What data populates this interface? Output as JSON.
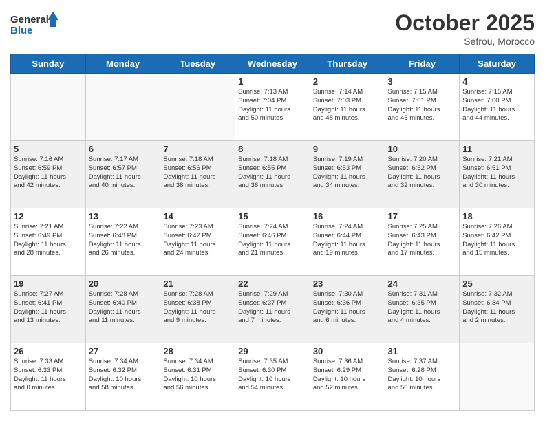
{
  "header": {
    "logo_line1": "General",
    "logo_line2": "Blue",
    "title": "October 2025",
    "location": "Sefrou, Morocco"
  },
  "days_of_week": [
    "Sunday",
    "Monday",
    "Tuesday",
    "Wednesday",
    "Thursday",
    "Friday",
    "Saturday"
  ],
  "weeks": [
    [
      {
        "day": "",
        "info": ""
      },
      {
        "day": "",
        "info": ""
      },
      {
        "day": "",
        "info": ""
      },
      {
        "day": "1",
        "info": "Sunrise: 7:13 AM\nSunset: 7:04 PM\nDaylight: 11 hours\nand 50 minutes."
      },
      {
        "day": "2",
        "info": "Sunrise: 7:14 AM\nSunset: 7:03 PM\nDaylight: 11 hours\nand 48 minutes."
      },
      {
        "day": "3",
        "info": "Sunrise: 7:15 AM\nSunset: 7:01 PM\nDaylight: 11 hours\nand 46 minutes."
      },
      {
        "day": "4",
        "info": "Sunrise: 7:15 AM\nSunset: 7:00 PM\nDaylight: 11 hours\nand 44 minutes."
      }
    ],
    [
      {
        "day": "5",
        "info": "Sunrise: 7:16 AM\nSunset: 6:59 PM\nDaylight: 11 hours\nand 42 minutes."
      },
      {
        "day": "6",
        "info": "Sunrise: 7:17 AM\nSunset: 6:57 PM\nDaylight: 11 hours\nand 40 minutes."
      },
      {
        "day": "7",
        "info": "Sunrise: 7:18 AM\nSunset: 6:56 PM\nDaylight: 11 hours\nand 38 minutes."
      },
      {
        "day": "8",
        "info": "Sunrise: 7:18 AM\nSunset: 6:55 PM\nDaylight: 11 hours\nand 36 minutes."
      },
      {
        "day": "9",
        "info": "Sunrise: 7:19 AM\nSunset: 6:53 PM\nDaylight: 11 hours\nand 34 minutes."
      },
      {
        "day": "10",
        "info": "Sunrise: 7:20 AM\nSunset: 6:52 PM\nDaylight: 11 hours\nand 32 minutes."
      },
      {
        "day": "11",
        "info": "Sunrise: 7:21 AM\nSunset: 6:51 PM\nDaylight: 11 hours\nand 30 minutes."
      }
    ],
    [
      {
        "day": "12",
        "info": "Sunrise: 7:21 AM\nSunset: 6:49 PM\nDaylight: 11 hours\nand 28 minutes."
      },
      {
        "day": "13",
        "info": "Sunrise: 7:22 AM\nSunset: 6:48 PM\nDaylight: 11 hours\nand 26 minutes."
      },
      {
        "day": "14",
        "info": "Sunrise: 7:23 AM\nSunset: 6:47 PM\nDaylight: 11 hours\nand 24 minutes."
      },
      {
        "day": "15",
        "info": "Sunrise: 7:24 AM\nSunset: 6:46 PM\nDaylight: 11 hours\nand 21 minutes."
      },
      {
        "day": "16",
        "info": "Sunrise: 7:24 AM\nSunset: 6:44 PM\nDaylight: 11 hours\nand 19 minutes."
      },
      {
        "day": "17",
        "info": "Sunrise: 7:25 AM\nSunset: 6:43 PM\nDaylight: 11 hours\nand 17 minutes."
      },
      {
        "day": "18",
        "info": "Sunrise: 7:26 AM\nSunset: 6:42 PM\nDaylight: 11 hours\nand 15 minutes."
      }
    ],
    [
      {
        "day": "19",
        "info": "Sunrise: 7:27 AM\nSunset: 6:41 PM\nDaylight: 11 hours\nand 13 minutes."
      },
      {
        "day": "20",
        "info": "Sunrise: 7:28 AM\nSunset: 6:40 PM\nDaylight: 11 hours\nand 11 minutes."
      },
      {
        "day": "21",
        "info": "Sunrise: 7:28 AM\nSunset: 6:38 PM\nDaylight: 11 hours\nand 9 minutes."
      },
      {
        "day": "22",
        "info": "Sunrise: 7:29 AM\nSunset: 6:37 PM\nDaylight: 11 hours\nand 7 minutes."
      },
      {
        "day": "23",
        "info": "Sunrise: 7:30 AM\nSunset: 6:36 PM\nDaylight: 11 hours\nand 6 minutes."
      },
      {
        "day": "24",
        "info": "Sunrise: 7:31 AM\nSunset: 6:35 PM\nDaylight: 11 hours\nand 4 minutes."
      },
      {
        "day": "25",
        "info": "Sunrise: 7:32 AM\nSunset: 6:34 PM\nDaylight: 11 hours\nand 2 minutes."
      }
    ],
    [
      {
        "day": "26",
        "info": "Sunrise: 7:33 AM\nSunset: 6:33 PM\nDaylight: 11 hours\nand 0 minutes."
      },
      {
        "day": "27",
        "info": "Sunrise: 7:34 AM\nSunset: 6:32 PM\nDaylight: 10 hours\nand 58 minutes."
      },
      {
        "day": "28",
        "info": "Sunrise: 7:34 AM\nSunset: 6:31 PM\nDaylight: 10 hours\nand 56 minutes."
      },
      {
        "day": "29",
        "info": "Sunrise: 7:35 AM\nSunset: 6:30 PM\nDaylight: 10 hours\nand 54 minutes."
      },
      {
        "day": "30",
        "info": "Sunrise: 7:36 AM\nSunset: 6:29 PM\nDaylight: 10 hours\nand 52 minutes."
      },
      {
        "day": "31",
        "info": "Sunrise: 7:37 AM\nSunset: 6:28 PM\nDaylight: 10 hours\nand 50 minutes."
      },
      {
        "day": "",
        "info": ""
      }
    ]
  ]
}
